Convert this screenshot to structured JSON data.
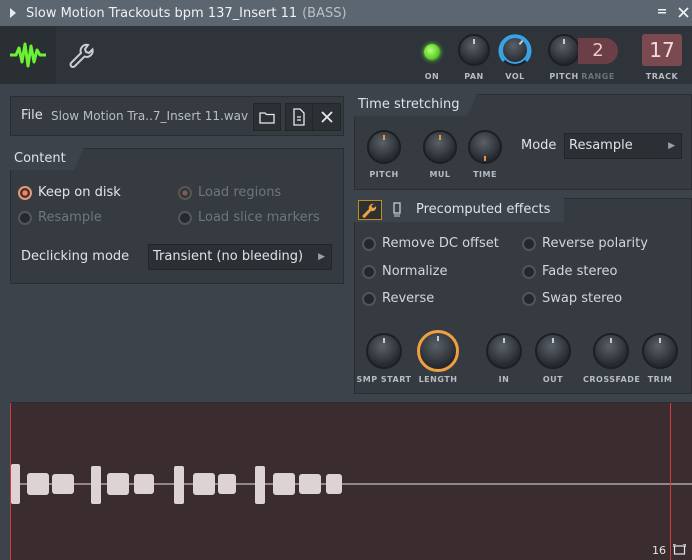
{
  "window": {
    "title": "Slow Motion Trackouts bpm 137_Insert 11",
    "subtitle": "(BASS)"
  },
  "toolbar": {
    "on_label": "ON",
    "pan_label": "PAN",
    "vol_label": "VOL",
    "pitch_label": "PITCH",
    "range_label": "RANGE",
    "range_value": "2",
    "track_label": "TRACK",
    "track_value": "17"
  },
  "file": {
    "label": "File",
    "value": "Slow Motion Tra..7_Insert 11.wav"
  },
  "content": {
    "title": "Content",
    "keep_on_disk": "Keep on disk",
    "load_regions": "Load regions",
    "resample": "Resample",
    "load_slice_markers": "Load slice markers",
    "declicking_label": "Declicking mode",
    "declicking_value": "Transient (no bleeding)"
  },
  "time_stretching": {
    "title": "Time stretching",
    "pitch_label": "PITCH",
    "mul_label": "MUL",
    "time_label": "TIME",
    "mode_label": "Mode",
    "mode_value": "Resample"
  },
  "precomputed": {
    "title": "Precomputed effects",
    "remove_dc": "Remove DC offset",
    "reverse_polarity": "Reverse polarity",
    "normalize": "Normalize",
    "fade_stereo": "Fade stereo",
    "reverse": "Reverse",
    "swap_stereo": "Swap stereo",
    "smp_start_label": "SMP START",
    "length_label": "LENGTH",
    "in_label": "IN",
    "out_label": "OUT",
    "crossfade_label": "CROSSFADE",
    "trim_label": "TRIM"
  },
  "waveform": {
    "zoom_value": "16"
  },
  "colors": {
    "accent_green": "#5ed12a",
    "accent_orange": "#f0a040",
    "wave_bg": "#3b2c30",
    "marker": "#d23b3b"
  }
}
